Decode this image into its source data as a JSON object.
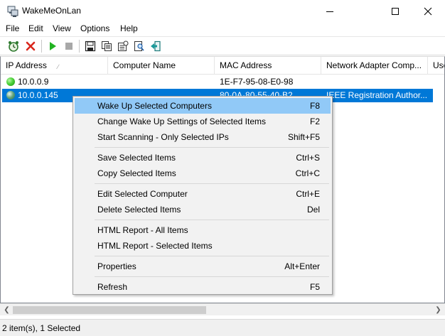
{
  "window": {
    "title": "WakeMeOnLan"
  },
  "menubar": {
    "items": [
      "File",
      "Edit",
      "View",
      "Options",
      "Help"
    ]
  },
  "toolbar": {
    "buttons": [
      {
        "icon": "alarm-clock-icon"
      },
      {
        "icon": "red-x-icon"
      },
      {
        "icon": "play-icon"
      },
      {
        "icon": "stop-icon"
      },
      {
        "icon": "save-icon"
      },
      {
        "icon": "copy-icon"
      },
      {
        "icon": "properties-icon"
      },
      {
        "icon": "find-icon"
      },
      {
        "icon": "exit-icon"
      }
    ]
  },
  "list": {
    "columns": [
      "IP Address",
      "Computer Name",
      "MAC Address",
      "Network Adapter Comp...",
      "Use"
    ],
    "rows": [
      {
        "ip": "10.0.0.9",
        "name": "",
        "mac": "1E-F7-95-08-E0-98",
        "adapter": "",
        "status_color": "#3cc22b",
        "selected": false
      },
      {
        "ip": "10.0.0.145",
        "name": "",
        "mac": "80-0A-80-55-40-B2",
        "adapter": "IEEE Registration Author...",
        "status_color": "#4c9a6a",
        "selected": true
      }
    ]
  },
  "context_menu": {
    "items": [
      {
        "label": "Wake Up Selected Computers",
        "shortcut": "F8",
        "highlighted": true
      },
      {
        "label": "Change Wake Up Settings of Selected Items",
        "shortcut": "F2"
      },
      {
        "label": "Start Scanning - Only Selected IPs",
        "shortcut": "Shift+F5"
      },
      {
        "label": "Save Selected Items",
        "shortcut": "Ctrl+S"
      },
      {
        "label": "Copy Selected Items",
        "shortcut": "Ctrl+C"
      },
      {
        "label": "Edit Selected Computer",
        "shortcut": "Ctrl+E"
      },
      {
        "label": "Delete Selected Items",
        "shortcut": "Del"
      },
      {
        "label": "HTML Report - All Items",
        "shortcut": ""
      },
      {
        "label": "HTML Report - Selected Items",
        "shortcut": ""
      },
      {
        "label": "Properties",
        "shortcut": "Alt+Enter"
      },
      {
        "label": "Refresh",
        "shortcut": "F5"
      }
    ]
  },
  "statusbar": {
    "text": "2 item(s), 1 Selected"
  },
  "colors": {
    "selection": "#0078d7",
    "menu_highlight": "#91c9f7"
  }
}
